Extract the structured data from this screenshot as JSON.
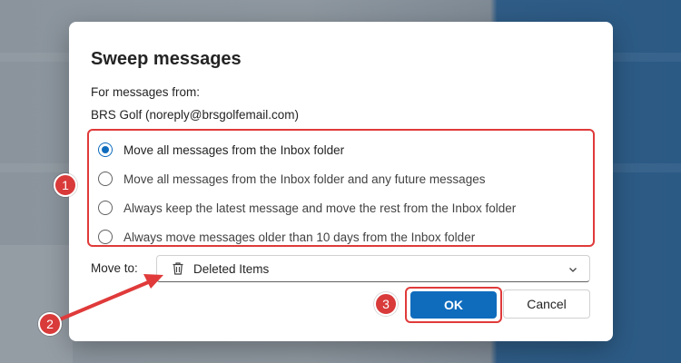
{
  "dialog": {
    "title": "Sweep messages",
    "from_label": "For messages from:",
    "sender": "BRS Golf (noreply@brsgolfemail.com)",
    "options": [
      {
        "label": "Move all messages from the Inbox folder",
        "selected": true
      },
      {
        "label": "Move all messages from the Inbox folder and any future messages",
        "selected": false
      },
      {
        "label": "Always keep the latest message and move the rest from the Inbox folder",
        "selected": false
      },
      {
        "label": "Always move messages older than 10 days from the Inbox folder",
        "selected": false
      }
    ],
    "move_to_label": "Move to:",
    "move_to_value": "Deleted Items",
    "move_to_icon": "trash-icon",
    "ok_label": "OK",
    "cancel_label": "Cancel"
  },
  "annotations": {
    "badge_1": "1",
    "badge_2": "2",
    "badge_3": "3",
    "highlight_color": "#e03a3a"
  },
  "colors": {
    "accent": "#0f6cbd",
    "badge": "#d93a3a"
  }
}
